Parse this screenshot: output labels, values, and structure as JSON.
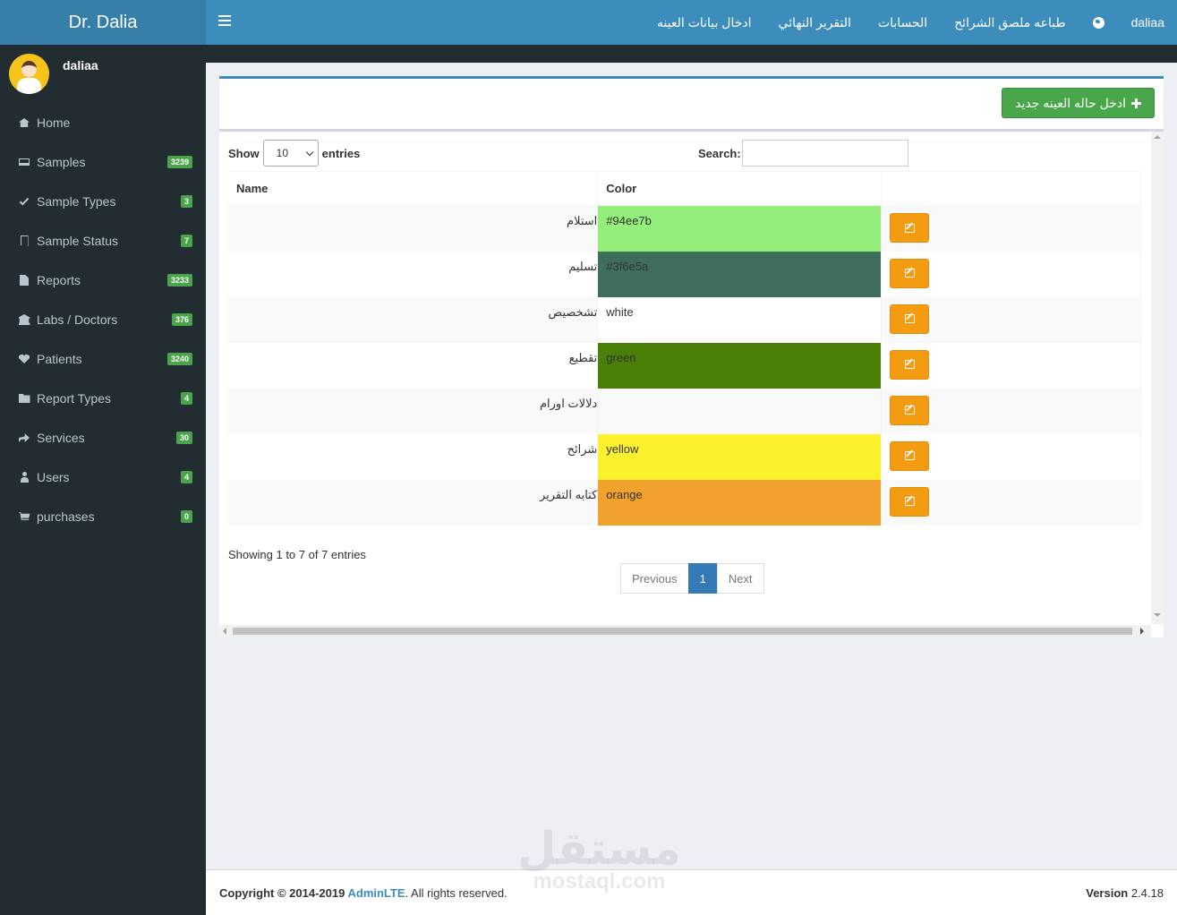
{
  "app": {
    "title": "Dr. Dalia"
  },
  "topnav": {
    "toggle_icon": "hamburger-icon",
    "links": [
      "daliaa",
      "طباعه ملصق الشرائح",
      "الحسابات",
      "التقرير النهائي",
      "ادخال بيانات العينه"
    ],
    "globe_icon": "globe-icon"
  },
  "sidebar": {
    "user": "daliaa",
    "items": [
      {
        "label": "Home",
        "icon": "home-icon",
        "badge": ""
      },
      {
        "label": "Samples",
        "icon": "laptop-icon",
        "badge": "3239"
      },
      {
        "label": "Sample Types",
        "icon": "check-icon",
        "badge": "3"
      },
      {
        "label": "Sample Status",
        "icon": "bookmark-icon",
        "badge": "7"
      },
      {
        "label": "Reports",
        "icon": "file-icon",
        "badge": "3233"
      },
      {
        "label": "Labs / Doctors",
        "icon": "bank-icon",
        "badge": "376"
      },
      {
        "label": "Patients",
        "icon": "heartbeat-icon",
        "badge": "3240"
      },
      {
        "label": "Report Types",
        "icon": "folder-open-icon",
        "badge": "4"
      },
      {
        "label": "Services",
        "icon": "share-icon",
        "badge": "30"
      },
      {
        "label": "Users",
        "icon": "user-icon",
        "badge": "4"
      },
      {
        "label": "purchases",
        "icon": "cart-icon",
        "badge": "0"
      }
    ]
  },
  "toolbar": {
    "add_label": "ادخل حاله العينه جديد",
    "add_icon": "plus-icon"
  },
  "table_controls": {
    "show_label": "Show",
    "entries_label": "entries",
    "page_size": "10",
    "search_label": "Search:",
    "search_value": ""
  },
  "table": {
    "headers": [
      "Name",
      "Color",
      ""
    ],
    "rows": [
      {
        "name": "استلام",
        "color": "#94ee7b",
        "swatch": "#94ee7b",
        "text_color": "#333333"
      },
      {
        "name": "تسليم",
        "color": "#3f6e5a",
        "swatch": "#3f6e5a",
        "text_color": "#333333"
      },
      {
        "name": "تشخصيص",
        "color": "white",
        "swatch": "#ffffff",
        "text_color": "#333333"
      },
      {
        "name": "تقطيع",
        "color": "green",
        "swatch": "#4a7f08",
        "text_color": "#333333"
      },
      {
        "name": "دلالات اورام",
        "color": "",
        "swatch": "",
        "text_color": "#333333"
      },
      {
        "name": "شرائح",
        "color": "yellow",
        "swatch": "#fbf22d",
        "text_color": "#333333"
      },
      {
        "name": "كتابه التقرير",
        "color": "orange",
        "swatch": "#f0a22d",
        "text_color": "#333333"
      }
    ],
    "edit_icon": "edit-icon"
  },
  "pagination": {
    "info": "Showing 1 to 7 of 7 entries",
    "previous": "Previous",
    "current": "1",
    "next": "Next"
  },
  "footer": {
    "copyright_prefix": "Copyright © 2014-2019 ",
    "brand": "AdminLTE",
    "suffix": ". All rights reserved.",
    "version_label": "Version",
    "version": "2.4.18"
  },
  "watermark": {
    "arabic": "مستقل",
    "latin": "mostaql.com"
  },
  "colors": {
    "header": "#3c8dbc",
    "logo": "#367fa9",
    "sidebar": "#222d32",
    "success": "#4aa64a",
    "warning": "#f39c12",
    "primary": "#337ab7"
  }
}
